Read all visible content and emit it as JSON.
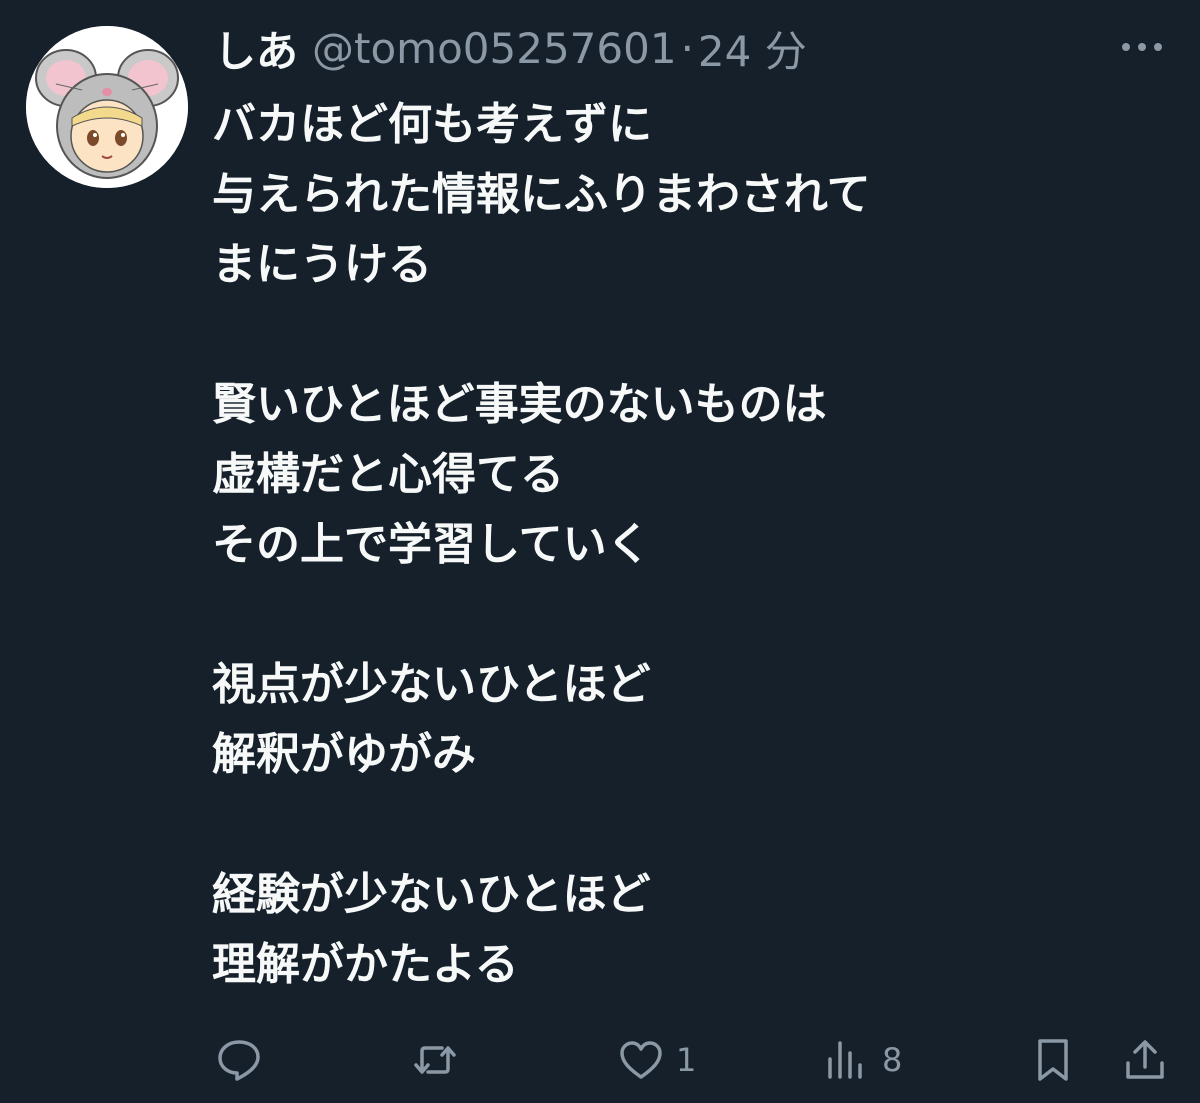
{
  "author": {
    "display_name": "しあ",
    "handle": "@tomo05257601",
    "separator": "·",
    "time": "24 分"
  },
  "tweet": {
    "lines": [
      "バカほど何も考えずに",
      "与えられた情報にふりまわされて",
      "まにうける",
      "",
      "賢いひとほど事実のないものは",
      "虚構だと心得てる",
      "その上で学習していく",
      "",
      "視点が少ないひとほど",
      "解釈がゆがみ",
      "",
      "経験が少ないひとほど",
      "理解がかたよる"
    ]
  },
  "actions": {
    "reply_icon": "reply-icon",
    "repost_icon": "repost-icon",
    "like_icon": "heart-icon",
    "like_count": "1",
    "views_icon": "views-icon",
    "views_count": "8",
    "bookmark_icon": "bookmark-icon",
    "share_icon": "share-icon"
  },
  "colors": {
    "background": "#15202b",
    "text": "#f7f9f9",
    "muted": "#8b98a5"
  }
}
